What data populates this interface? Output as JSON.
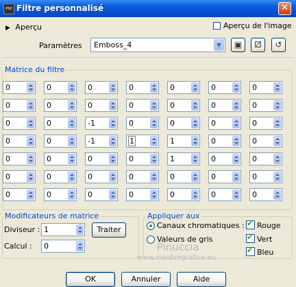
{
  "window": {
    "title": "Filtre personnalisé",
    "app_icon": "PSP"
  },
  "preview": {
    "toggle_label": "Aperçu",
    "image_preview_label": "Aperçu de l'image",
    "image_preview_checked": false
  },
  "params": {
    "label": "Paramètres",
    "preset_value": "Emboss_4",
    "icons": [
      "save-preset-icon",
      "presets-folder-icon",
      "restore-icon"
    ]
  },
  "matrix": {
    "title": "Matrice du filtre",
    "rows": [
      [
        "0",
        "0",
        "0",
        "0",
        "0",
        "0",
        "0"
      ],
      [
        "0",
        "0",
        "0",
        "0",
        "0",
        "0",
        "0"
      ],
      [
        "0",
        "0",
        "-1",
        "0",
        "0",
        "0",
        "0"
      ],
      [
        "0",
        "0",
        "-1",
        "1",
        "1",
        "0",
        "0"
      ],
      [
        "0",
        "0",
        "0",
        "0",
        "1",
        "0",
        "0"
      ],
      [
        "0",
        "0",
        "0",
        "0",
        "0",
        "0",
        "0"
      ],
      [
        "0",
        "0",
        "0",
        "0",
        "0",
        "0",
        "0"
      ]
    ]
  },
  "modifiers": {
    "title": "Modificateurs de matrice",
    "divisor_label": "Diviseur :",
    "divisor_value": "1",
    "bias_label": "Calcul :",
    "bias_value": "0",
    "process_button": "Traiter"
  },
  "apply": {
    "title": "Appliquer aux",
    "color_channels": "Canaux chromatiques :",
    "grey_values": "Valeurs de gris",
    "red": "Rouge",
    "green": "Vert",
    "blue": "Bleu",
    "selected_mode": "color_channels"
  },
  "buttons": {
    "ok": "OK",
    "cancel": "Annuler",
    "help": "Aide"
  },
  "watermark": {
    "name": "Pinuccia",
    "site": "www.maidiregrafica.eu"
  }
}
